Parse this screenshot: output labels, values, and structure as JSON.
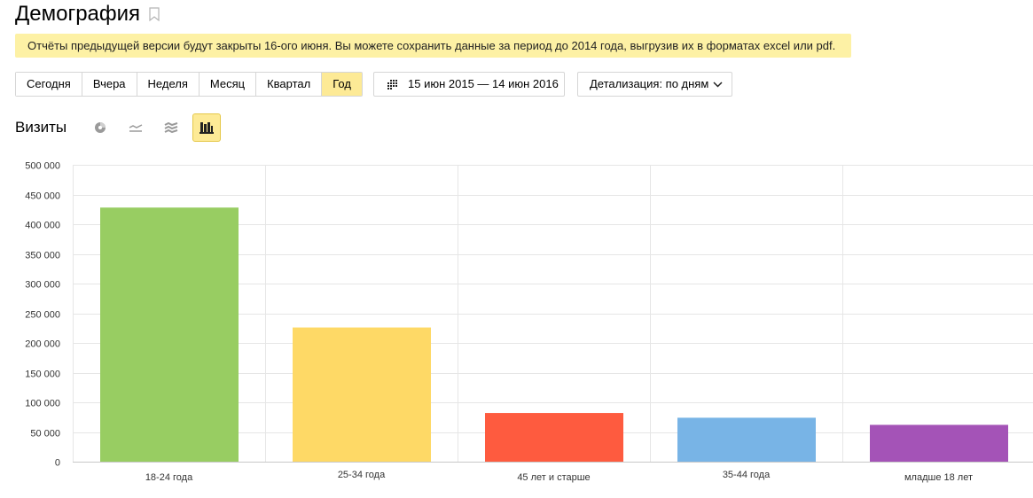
{
  "page": {
    "title": "Демография"
  },
  "notice": {
    "text": "Отчёты предыдущей версии будут закрыты 16-ого июня. Вы можете сохранить данные за период до 2014 года, выгрузив их в форматах excel или pdf."
  },
  "period": {
    "buttons": [
      "Сегодня",
      "Вчера",
      "Неделя",
      "Месяц",
      "Квартал",
      "Год"
    ],
    "active": "Год"
  },
  "date_range": {
    "label": "15 июн 2015 — 14 июн 2016",
    "icon": "calendar-icon"
  },
  "detail": {
    "label": "Детализация: по дням",
    "icon": "chevron-down-icon"
  },
  "metric": {
    "label": "Визиты"
  },
  "chart_types": [
    {
      "icon": "pie-chart-icon",
      "active": false
    },
    {
      "icon": "line-chart-icon",
      "active": false
    },
    {
      "icon": "area-chart-icon",
      "active": false
    },
    {
      "icon": "bar-chart-icon",
      "active": true
    }
  ],
  "chart_data": {
    "type": "bar",
    "categories": [
      "18-24 года",
      "25-34 года",
      "45 лет и старше",
      "35-44 года",
      "младше 18 лет"
    ],
    "values": [
      428000,
      226000,
      82000,
      74000,
      62000
    ],
    "colors": [
      "#98cd62",
      "#fed966",
      "#fe5b3f",
      "#78b4e6",
      "#a453b7"
    ],
    "ylim": [
      0,
      500000
    ],
    "yticks": [
      0,
      50000,
      100000,
      150000,
      200000,
      250000,
      300000,
      350000,
      400000,
      450000,
      500000
    ],
    "ytick_labels": [
      "0",
      "50 000",
      "100 000",
      "150 000",
      "200 000",
      "250 000",
      "300 000",
      "350 000",
      "400 000",
      "450 000",
      "500 000"
    ],
    "grid": true,
    "legend": "none"
  }
}
